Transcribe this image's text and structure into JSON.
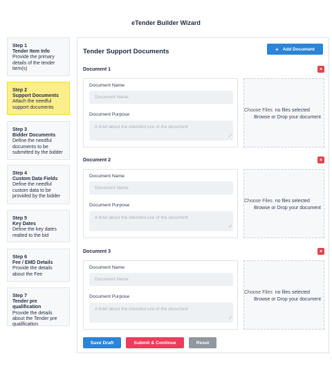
{
  "page": {
    "title": "eTender Builder Wizard"
  },
  "steps": [
    {
      "num": "Step 1",
      "name": "Tender Item Info",
      "desc": "Provide the primary details of the tender item(s)",
      "active": false
    },
    {
      "num": "Step 2",
      "name": "Support Documents",
      "desc": "Attach the needful support documents",
      "active": true
    },
    {
      "num": "Step 3",
      "name": "Bidder Documents",
      "desc": "Define the needful documents to be submitted by the bidder",
      "active": false
    },
    {
      "num": "Step 4",
      "name": "Custom Data Fields",
      "desc": "Define the needful custom data to be provided by the bidder",
      "active": false
    },
    {
      "num": "Step 5",
      "name": "Key Dates",
      "desc": "Define the key dates realted to the bid",
      "active": false
    },
    {
      "num": "Step 6",
      "name": "Fee / EMD Details",
      "desc": "Provide the details about the Fee",
      "active": false
    },
    {
      "num": "Step 7",
      "name": "Tender pre qualification",
      "desc": "Provide the details about the Tender pre qualification",
      "active": false
    }
  ],
  "main": {
    "title": "Tender Support Documents",
    "add_button": "Add Document",
    "add_icon": "+",
    "close_icon": "×",
    "documents": [
      {
        "title": "Document 1",
        "name_label": "Document Name",
        "name_placeholder": "Document Name",
        "purpose_label": "Document Purpose",
        "purpose_placeholder": "A brief about the intended use of the document",
        "choose_files": "Choose Files",
        "no_files": "no files selected",
        "browse": "Browse or Drop your document"
      },
      {
        "title": "Document 2",
        "name_label": "Document Name",
        "name_placeholder": "Document Name",
        "purpose_label": "Document Purpose",
        "purpose_placeholder": "A brief about the intended use of the document",
        "choose_files": "Choose Files",
        "no_files": "no files selected",
        "browse": "Browse or Drop your document"
      },
      {
        "title": "Document 3",
        "name_label": "Document Name",
        "name_placeholder": "Document Name",
        "purpose_label": "Document Purpose",
        "purpose_placeholder": "A brief about the intended use of the document",
        "choose_files": "Choose Files",
        "no_files": "no files selected",
        "browse": "Browse or Drop your document"
      }
    ],
    "actions": {
      "save": "Save Draft",
      "submit": "Submit & Continue",
      "reset": "Reset"
    }
  },
  "colors": {
    "primary": "#2b84d6",
    "danger": "#ee3b5c",
    "close": "#e0444d",
    "muted": "#8f979f",
    "active_step": "#fcee8a"
  }
}
